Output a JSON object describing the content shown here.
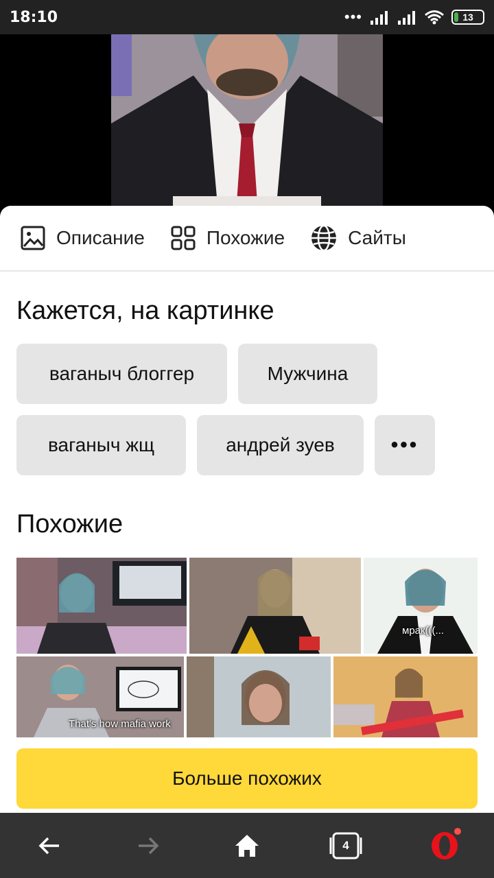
{
  "status_bar": {
    "time": "18:10",
    "dots": "•••",
    "battery": "13"
  },
  "tabs": [
    {
      "label": "Описание",
      "icon": "image-icon"
    },
    {
      "label": "Похожие",
      "icon": "grid-icon"
    },
    {
      "label": "Сайты",
      "icon": "globe-icon"
    }
  ],
  "recognized": {
    "title": "Кажется, на картинке",
    "chips": [
      "ваганыч блоггер",
      "Мужчина",
      "ваганыч жщ",
      "андрей зуев"
    ],
    "more_chip": "•••"
  },
  "similar": {
    "title": "Похожие",
    "captions": {
      "thumb3": "мрак(((...",
      "thumb4": "That's how mafia work"
    },
    "more_button": "Больше похожих"
  },
  "bottom_nav": {
    "tabs_count": "4"
  },
  "colors": {
    "accent_yellow": "#ffd83a",
    "opera_red": "#e8121b",
    "chip_bg": "#e5e5e5"
  }
}
